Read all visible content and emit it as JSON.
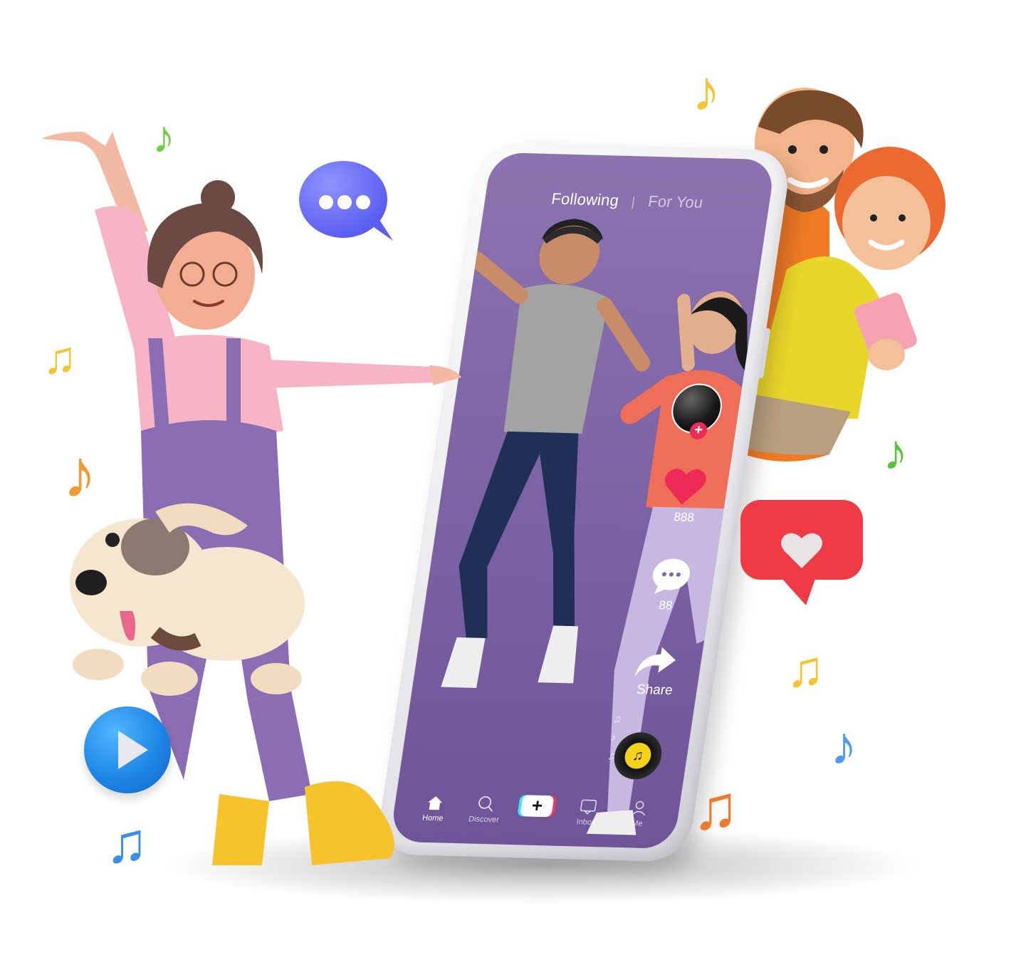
{
  "feed": {
    "tab_following": "Following",
    "separator": "|",
    "tab_for_you": "For You"
  },
  "rail": {
    "follow_plus": "+",
    "likes_count": "888",
    "comments_count": "88",
    "share_label": "Share",
    "music_icon": "♫"
  },
  "bottom_nav": {
    "home": "Home",
    "discover": "Discover",
    "create": "+",
    "inbox": "Inbox",
    "me": "Me"
  },
  "colors": {
    "screen_purple": "#7d65a6",
    "like_red": "#ee2a56",
    "accent_cyan": "#44e3f0",
    "accent_pink": "#f0375c",
    "music_yellow": "#f5d31b"
  },
  "decor_icons": [
    "chat-bubble-icon",
    "play-icon",
    "heart-notification-icon",
    "music-note-icon",
    "dog",
    "dancing-girl",
    "couple-with-phone"
  ]
}
